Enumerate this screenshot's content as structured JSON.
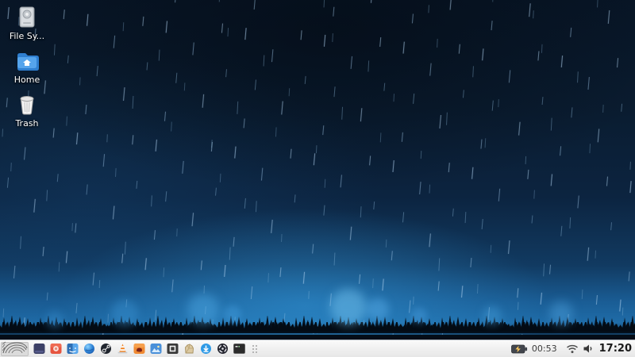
{
  "desktop": {
    "wallpaper": "dark-blue-rain-over-grass",
    "icons": [
      {
        "name": "file-system",
        "label": "File Sy...",
        "icon": "hard-drive-icon"
      },
      {
        "name": "home",
        "label": "Home",
        "icon": "blue-folder-home-icon"
      },
      {
        "name": "trash",
        "label": "Trash",
        "icon": "trash-can-icon"
      }
    ]
  },
  "taskbar": {
    "launchers": [
      {
        "name": "whisker-menu",
        "icon": "swirl-logo-icon"
      },
      {
        "name": "indigo-app",
        "icon": "dark-indigo-square-icon"
      },
      {
        "name": "camera-app",
        "icon": "red-camera-icon"
      },
      {
        "name": "finder-face-app",
        "icon": "blue-face-icon"
      },
      {
        "name": "browser",
        "icon": "blue-globe-icon"
      },
      {
        "name": "steam",
        "icon": "steam-piston-icon"
      },
      {
        "name": "vlc",
        "icon": "orange-cone-icon"
      },
      {
        "name": "orange-app",
        "icon": "orange-blob-icon"
      },
      {
        "name": "photos-app",
        "icon": "blue-photo-icon"
      },
      {
        "name": "screenshot-app",
        "icon": "dark-square-frame-icon"
      },
      {
        "name": "archive-app",
        "icon": "tan-package-icon"
      },
      {
        "name": "download-app",
        "icon": "blue-down-arrow-icon"
      },
      {
        "name": "obs-studio",
        "icon": "dark-aperture-icon"
      },
      {
        "name": "terminal",
        "icon": "terminal-icon"
      }
    ],
    "tray": {
      "battery_icon": "battery-charging-icon",
      "battery_time": "00:53",
      "network_icon": "wifi-icon",
      "volume_icon": "volume-icon",
      "clock": "17:20"
    }
  },
  "colors": {
    "panel_bg": "#efefef",
    "wallpaper_base": "#0c2440",
    "wallpaper_glow": "#1f6ca8",
    "folder_blue": "#4a9ce8",
    "battery_bolt": "#ffc95e",
    "label_text": "#ffffff",
    "clock_text": "#1a1a1a"
  }
}
